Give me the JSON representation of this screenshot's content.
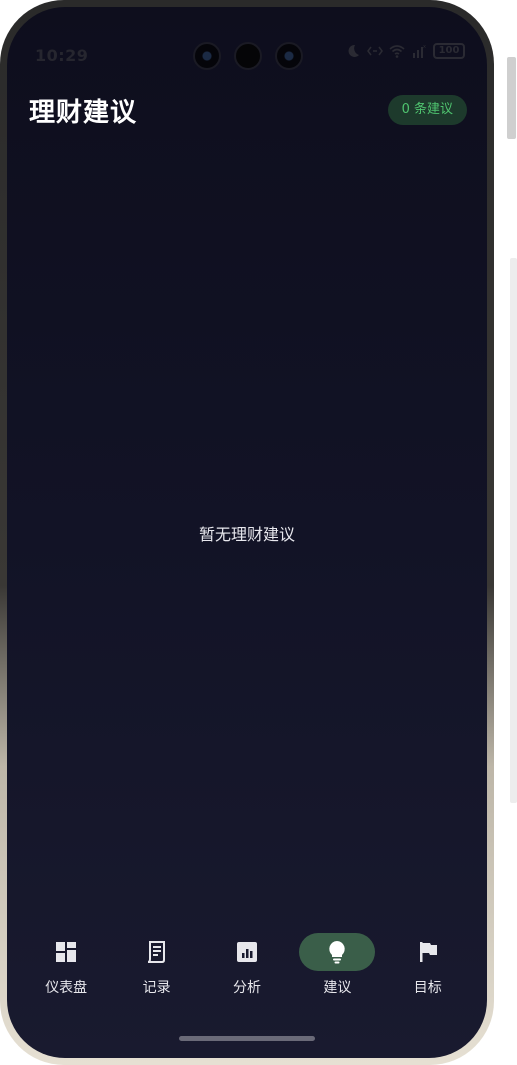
{
  "status_bar": {
    "time": "10:29",
    "battery": "100",
    "signal_marker": "x"
  },
  "header": {
    "title": "理财建议",
    "badge": "0 条建议"
  },
  "main": {
    "empty_message": "暂无理财建议"
  },
  "bottom_nav": {
    "items": [
      {
        "label": "仪表盘",
        "icon": "dashboard-icon"
      },
      {
        "label": "记录",
        "icon": "receipt-icon"
      },
      {
        "label": "分析",
        "icon": "bar-chart-icon"
      },
      {
        "label": "建议",
        "icon": "lightbulb-icon",
        "active": true
      },
      {
        "label": "目标",
        "icon": "flag-icon"
      }
    ]
  },
  "colors": {
    "background": "#121326",
    "accent_green": "#4fc36f",
    "badge_bg": "#1d3a2c",
    "active_tab_bg": "#3a5e49",
    "text": "#ffffff"
  }
}
